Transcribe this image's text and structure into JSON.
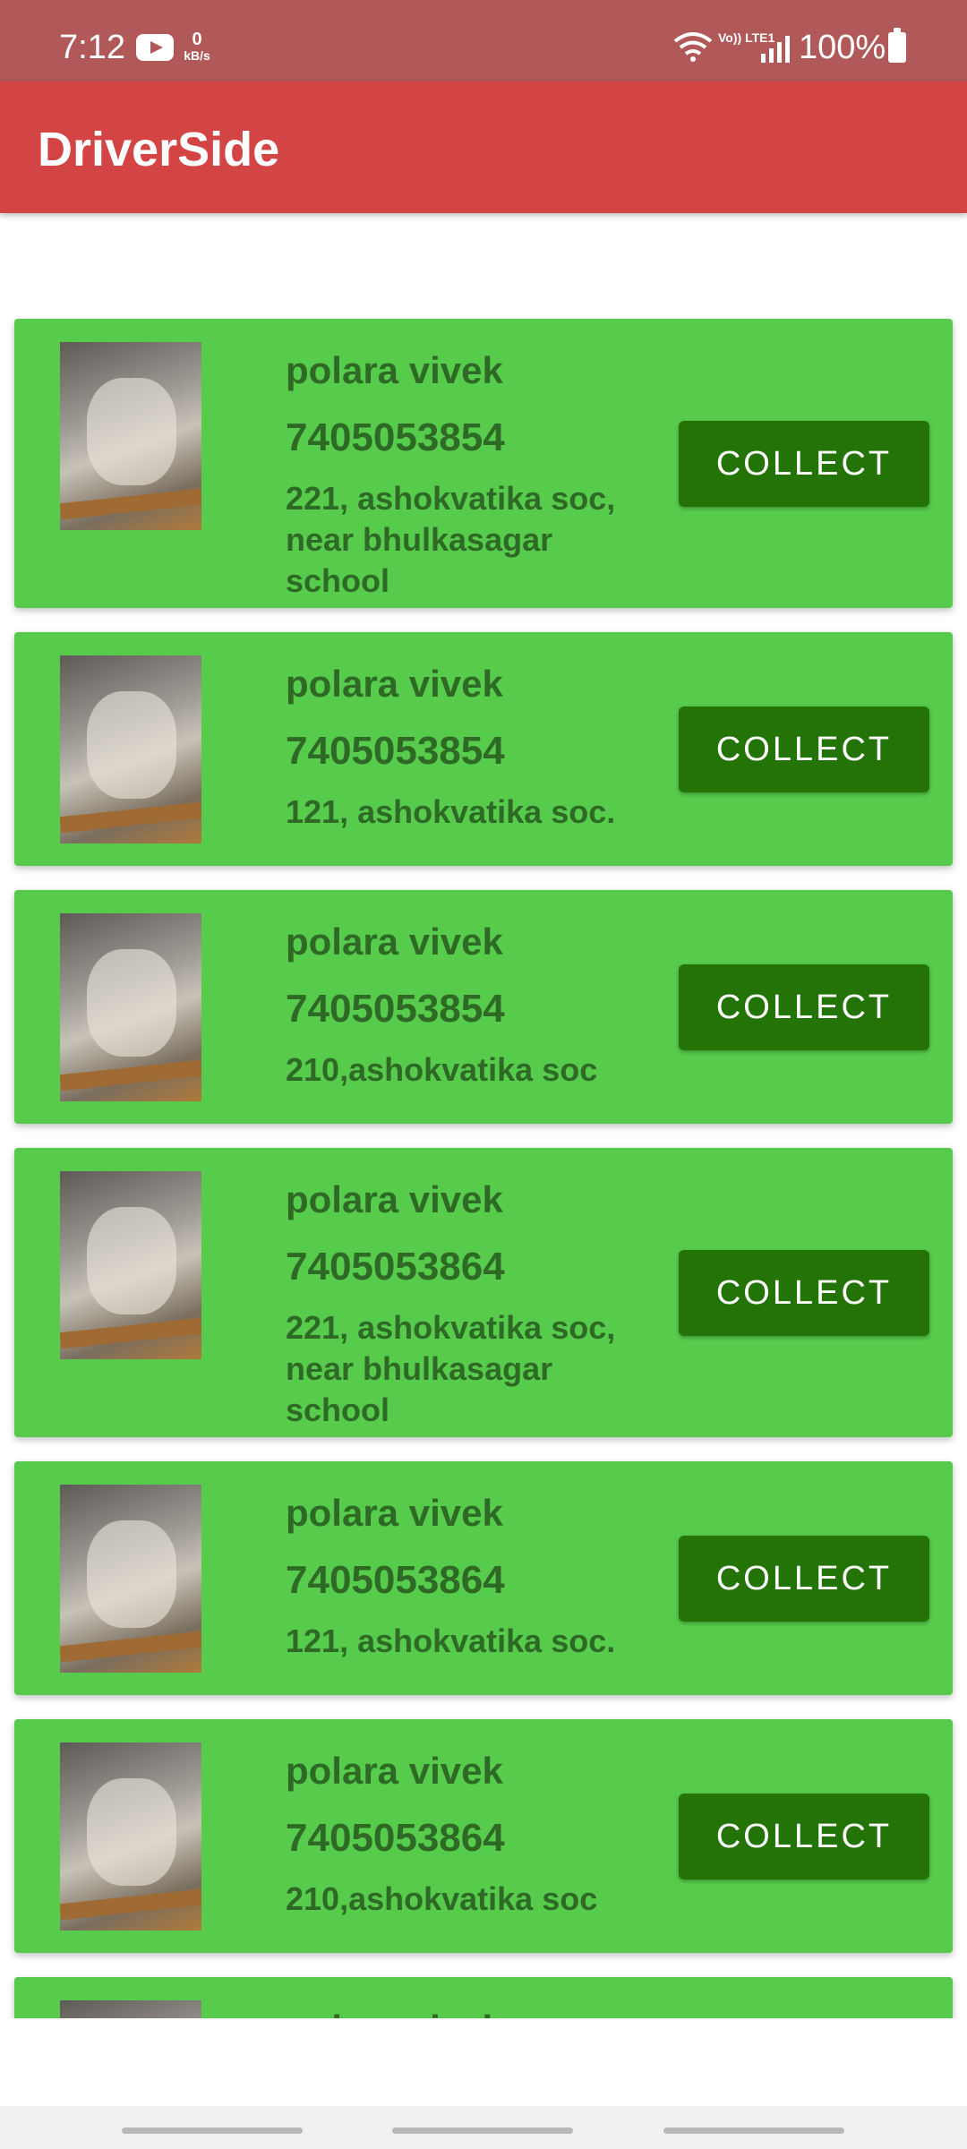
{
  "status_bar": {
    "time": "7:12",
    "net_speed_value": "0",
    "net_speed_unit": "kB/s",
    "volte_label": "Vo)) LTE1",
    "battery": "100%",
    "icons": [
      "youtube-icon",
      "wifi-icon",
      "volte-icon",
      "signal-icon",
      "battery-icon"
    ]
  },
  "app_bar": {
    "title": "DriverSide"
  },
  "colors": {
    "status_bar": "#b15959",
    "app_bar": "#d34444",
    "card": "#57cc4c",
    "button": "#237307",
    "card_text": "#2e6a26"
  },
  "orders": [
    {
      "name": "polara vivek",
      "phone": "7405053854",
      "address": "221, ashokvatika soc, near bhulkasagar school",
      "button": "COLLECT"
    },
    {
      "name": "polara vivek",
      "phone": "7405053854",
      "address": "121, ashokvatika soc.",
      "button": "COLLECT"
    },
    {
      "name": "polara vivek",
      "phone": "7405053854",
      "address": "210,ashokvatika soc",
      "button": "COLLECT"
    },
    {
      "name": "polara vivek",
      "phone": "7405053864",
      "address": "221, ashokvatika soc, near bhulkasagar school",
      "button": "COLLECT"
    },
    {
      "name": "polara vivek",
      "phone": "7405053864",
      "address": "121, ashokvatika soc.",
      "button": "COLLECT"
    },
    {
      "name": "polara vivek",
      "phone": "7405053864",
      "address": "210,ashokvatika soc",
      "button": "COLLECT"
    },
    {
      "name": "polara vivek",
      "phone": "",
      "address": "",
      "button": ""
    }
  ]
}
